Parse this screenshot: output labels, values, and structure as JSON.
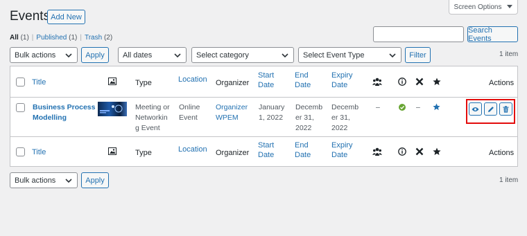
{
  "page": {
    "title": "Events",
    "add_new": "Add New",
    "screen_options": "Screen Options"
  },
  "filters": {
    "all": "All",
    "all_count": "(1)",
    "published": "Published",
    "published_count": "(1)",
    "trash": "Trash",
    "trash_count": "(2)",
    "separator": "|"
  },
  "search": {
    "button": "Search Events",
    "value": ""
  },
  "toolbar_top": {
    "bulk_actions": "Bulk actions",
    "apply": "Apply",
    "dates": "All dates",
    "category": "Select category",
    "event_type": "Select Event Type",
    "filter": "Filter",
    "items_count": "1 item"
  },
  "toolbar_bottom": {
    "bulk_actions": "Bulk actions",
    "apply": "Apply",
    "items_count": "1 item"
  },
  "columns": {
    "title": "Title",
    "type": "Type",
    "location": "Location",
    "organizer": "Organizer",
    "start_date_1": "Start",
    "start_date_2": "Date",
    "end_date_1": "End",
    "end_date_2": "Date",
    "expiry_date_1": "Expiry",
    "expiry_date_2": "Date",
    "actions": "Actions",
    "icons": [
      "image-icon",
      "group-icon",
      "info-icon",
      "cancelled-icon",
      "featured-star-icon"
    ]
  },
  "row": {
    "title_1": "Business Process",
    "title_2": "Modelling",
    "type_1": "Meeting or",
    "type_2": "Networkin",
    "type_3": "g Event",
    "location_1": "Online",
    "location_2": "Event",
    "organizer_1": "Organizer",
    "organizer_2": "WPEM",
    "start_1": "January",
    "start_2": "1, 2022",
    "end_1": "Decemb",
    "end_2": "er 31,",
    "end_3": "2022",
    "expiry_1": "Decemb",
    "expiry_2": "er 31,",
    "expiry_3": "2022",
    "dash": "–",
    "filled_dash": "–"
  },
  "colors": {
    "accent": "#2271b1",
    "highlight": "#e30b0b",
    "success": "#68a533"
  }
}
